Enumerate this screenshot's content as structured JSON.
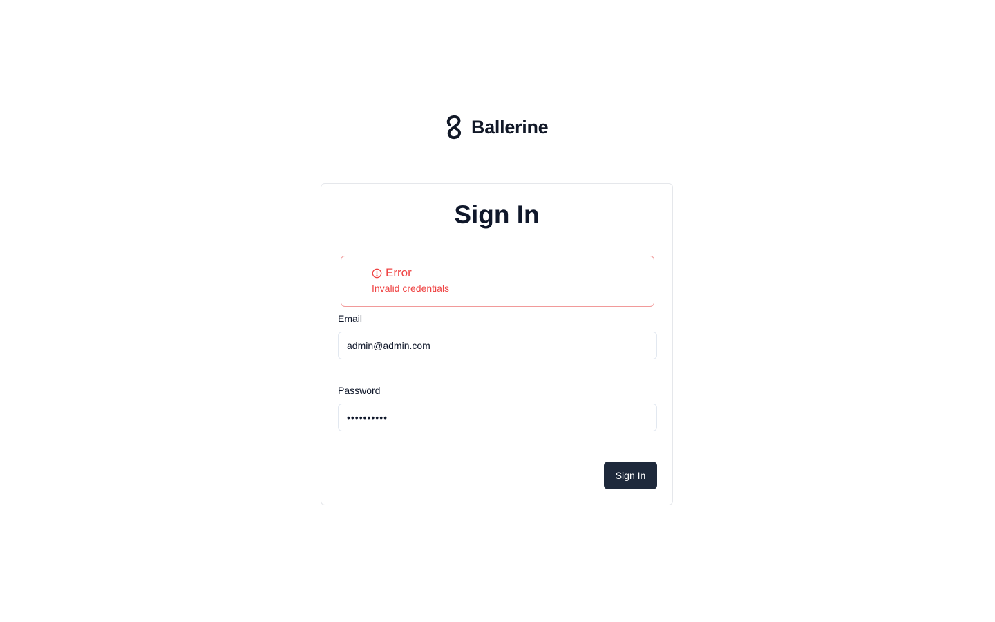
{
  "brand": {
    "name": "Ballerine",
    "logo_icon": "ballerine-logo-icon",
    "color": "#111827"
  },
  "form": {
    "title": "Sign In",
    "alert": {
      "icon": "alert-circle-icon",
      "title": "Error",
      "message": "Invalid credentials",
      "color": "#ef4444"
    },
    "email": {
      "label": "Email",
      "value": "admin@admin.com"
    },
    "password": {
      "label": "Password",
      "value": "••••••••••"
    },
    "submit_label": "Sign In",
    "submit_color": "#1e293b"
  }
}
